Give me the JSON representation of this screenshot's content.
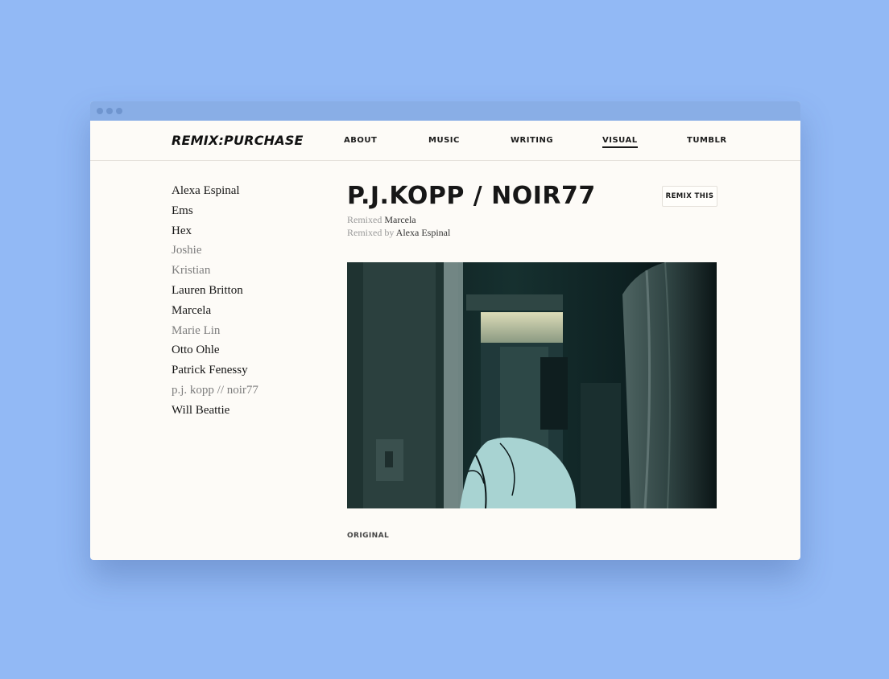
{
  "nav": {
    "logo": "REMIX:PURCHASE",
    "items": [
      {
        "label": "ABOUT",
        "active": false
      },
      {
        "label": "MUSIC",
        "active": false
      },
      {
        "label": "WRITING",
        "active": false
      },
      {
        "label": "VISUAL",
        "active": true
      },
      {
        "label": "TUMBLR",
        "active": false
      }
    ]
  },
  "sidebar": {
    "items": [
      {
        "label": "Alexa Espinal",
        "muted": false
      },
      {
        "label": "Ems",
        "muted": false
      },
      {
        "label": "Hex",
        "muted": false
      },
      {
        "label": "Joshie",
        "muted": true
      },
      {
        "label": "Kristian",
        "muted": true
      },
      {
        "label": "Lauren Britton",
        "muted": false
      },
      {
        "label": "Marcela",
        "muted": false
      },
      {
        "label": "Marie Lin",
        "muted": true
      },
      {
        "label": "Otto Ohle",
        "muted": false
      },
      {
        "label": "Patrick Fenessy",
        "muted": false
      },
      {
        "label": "p.j. kopp // noir77",
        "muted": true
      },
      {
        "label": "Will Beattie",
        "muted": false
      }
    ]
  },
  "main": {
    "title": "P.J.KOPP / NOIR77",
    "remixed_label": "Remixed",
    "remixed_value": "Marcela",
    "remixed_by_label": "Remixed by",
    "remixed_by_value": "Alexa Espinal",
    "remix_button": "REMIX THIS",
    "original_label": "ORIGINAL"
  },
  "colors": {
    "background": "#92b9f5",
    "titlebar": "#89aee6",
    "page": "#fdfbf7",
    "figure": "#a8d3d2"
  }
}
